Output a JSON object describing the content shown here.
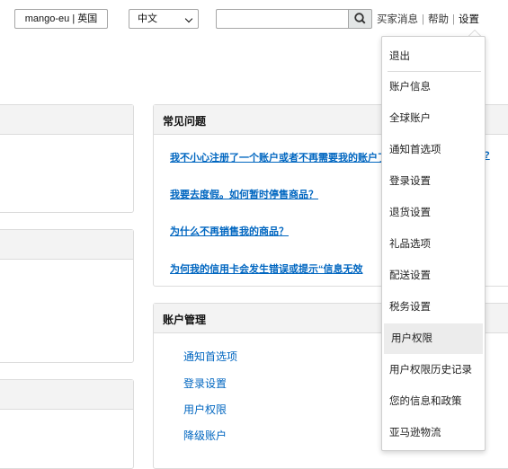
{
  "header": {
    "store_label": "mango-eu | 英国",
    "language_value": "中文",
    "search_placeholder": "",
    "links": [
      "买家消息",
      "帮助",
      "设置"
    ]
  },
  "faq": {
    "title": "常见问题",
    "questions": [
      "我不小心注册了一个账户或者不再需要我的账户了",
      "我要去度假。如何暂时停售商品？",
      "为什么不再销售我的商品？",
      "为何我的信用卡会发生错误或提示“信息无效"
    ],
    "trailing_mark": "?"
  },
  "account_management": {
    "title": "账户管理",
    "links": [
      "通知首选项",
      "登录设置",
      "用户权限",
      "降级账户"
    ]
  },
  "settings_menu": {
    "items": [
      "退出",
      "账户信息",
      "全球账户",
      "通知首选项",
      "登录设置",
      "退货设置",
      "礼品选项",
      "配送设置",
      "税务设置",
      "用户权限",
      "用户权限历史记录",
      "您的信息和政策",
      "亚马逊物流"
    ],
    "highlighted": "用户权限"
  },
  "colors": {
    "link": "#0066c0",
    "panel_header": "#f3f3f3",
    "highlight": "#ececec"
  }
}
